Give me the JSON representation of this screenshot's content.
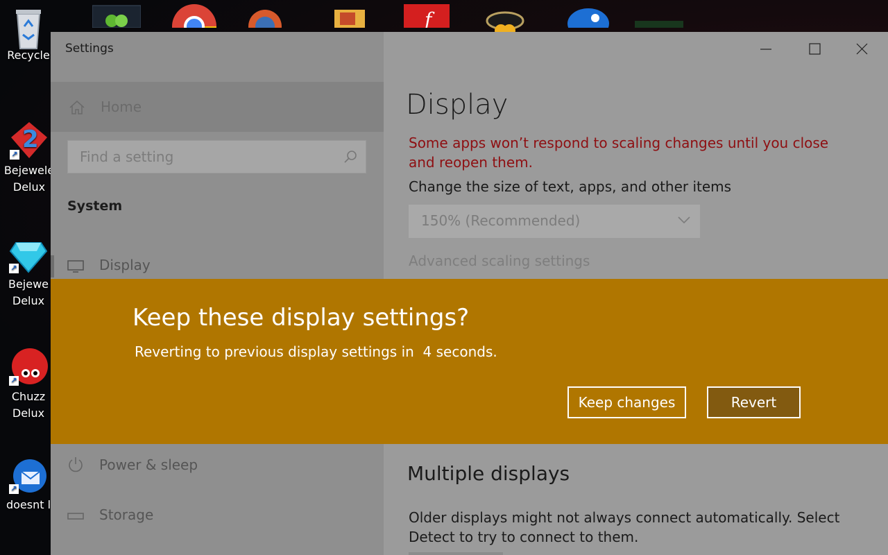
{
  "desktop": {
    "icons": [
      {
        "label": "Recycle"
      },
      {
        "label": "Bejewele\nDelux"
      },
      {
        "label": "Bejewe\nDelux"
      },
      {
        "label": "Chuzz\nDelux"
      },
      {
        "label": "doesnt l"
      }
    ]
  },
  "window": {
    "title": "Settings",
    "controls": {
      "minimize": "minimize",
      "maximize": "maximize",
      "close": "close"
    }
  },
  "sidebar": {
    "home_label": "Home",
    "search_placeholder": "Find a setting",
    "section_label": "System",
    "items": [
      {
        "label": "Display",
        "icon": "monitor-icon",
        "active": true
      },
      {
        "label": "Power & sleep",
        "icon": "power-icon",
        "active": false
      },
      {
        "label": "Storage",
        "icon": "storage-icon",
        "active": false
      }
    ]
  },
  "main": {
    "page_title": "Display",
    "warning": "Some apps won’t respond to scaling changes until you close and reopen them.",
    "size_label": "Change the size of text, apps, and other items",
    "scale_value": "150% (Recommended)",
    "advanced_link": "Advanced scaling settings",
    "multiple_title": "Multiple displays",
    "multiple_desc": "Older displays might not always connect automatically. Select Detect to try to connect to them."
  },
  "dialog": {
    "title": "Keep these display settings?",
    "message": "Reverting to previous display settings in  4 seconds.",
    "keep_label": "Keep changes",
    "revert_label": "Revert",
    "background": "#b07600",
    "warning_color": "#8e0f12"
  }
}
